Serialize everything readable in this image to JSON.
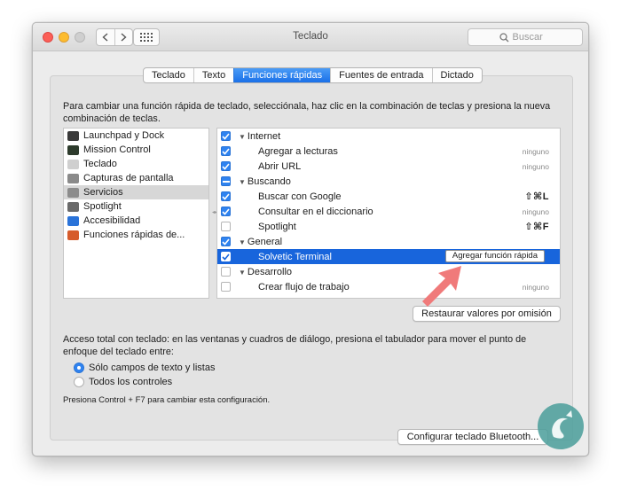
{
  "window": {
    "title": "Teclado"
  },
  "search": {
    "placeholder": "Buscar"
  },
  "tabs": [
    {
      "label": "Teclado",
      "active": false
    },
    {
      "label": "Texto",
      "active": false
    },
    {
      "label": "Funciones rápidas",
      "active": true
    },
    {
      "label": "Fuentes de entrada",
      "active": false
    },
    {
      "label": "Dictado",
      "active": false
    }
  ],
  "intro_text": "Para cambiar una función rápida de teclado, selecciónala, haz clic en la combinación de teclas y presiona la nueva combinación de teclas.",
  "categories": [
    {
      "label": "Launchpad y Dock",
      "icon": "launchpad-icon",
      "color": "#3a3a3a"
    },
    {
      "label": "Mission Control",
      "icon": "mission-control-icon",
      "color": "#2d3b2c"
    },
    {
      "label": "Teclado",
      "icon": "keyboard-icon",
      "color": "#cfcfcf"
    },
    {
      "label": "Capturas de pantalla",
      "icon": "screenshot-icon",
      "color": "#8a8a8a"
    },
    {
      "label": "Servicios",
      "icon": "gear-icon",
      "color": "#8c8c8c",
      "selected": true
    },
    {
      "label": "Spotlight",
      "icon": "spotlight-icon",
      "color": "#6a6a6a"
    },
    {
      "label": "Accesibilidad",
      "icon": "accessibility-icon",
      "color": "#2a73d9"
    },
    {
      "label": "Funciones rápidas de...",
      "icon": "app-shortcuts-icon",
      "color": "#d65c2c"
    }
  ],
  "shortcuts": [
    {
      "type": "group",
      "label": "Internet",
      "check": "on"
    },
    {
      "type": "item",
      "label": "Agregar a lecturas",
      "check": "on",
      "key": "ninguno"
    },
    {
      "type": "item",
      "label": "Abrir URL",
      "check": "on",
      "key": "ninguno"
    },
    {
      "type": "group",
      "label": "Buscando",
      "check": "mixed"
    },
    {
      "type": "item",
      "label": "Buscar con Google",
      "check": "on",
      "key": "⇧⌘L",
      "combo": true
    },
    {
      "type": "item",
      "label": "Consultar en el diccionario",
      "check": "on",
      "key": "ninguno"
    },
    {
      "type": "item",
      "label": "Spotlight",
      "check": "off",
      "key": "⇧⌘F",
      "combo": true
    },
    {
      "type": "group",
      "label": "General",
      "check": "on"
    },
    {
      "type": "item",
      "label": "Solvetic Terminal",
      "check": "on",
      "key": "",
      "selected": true,
      "button": "Agregar función rápida"
    },
    {
      "type": "group",
      "label": "Desarrollo",
      "check": "off"
    },
    {
      "type": "item",
      "label": "Crear flujo de trabajo",
      "check": "off",
      "key": "ninguno"
    }
  ],
  "restore_button": "Restaurar valores por omisión",
  "access": {
    "text": "Acceso total con teclado: en las ventanas y cuadros de diálogo, presiona el tabulador para mover el punto de enfoque del teclado entre:",
    "options": [
      {
        "label": "Sólo campos de texto y listas",
        "selected": true
      },
      {
        "label": "Todos los controles",
        "selected": false
      }
    ],
    "hint": "Presiona Control + F7 para cambiar esta configuración."
  },
  "bluetooth_button": "Configurar teclado Bluetooth...",
  "colors": {
    "accent": "#1865dc",
    "arrow": "#f07a7a",
    "logo": "#4a9d9a"
  }
}
